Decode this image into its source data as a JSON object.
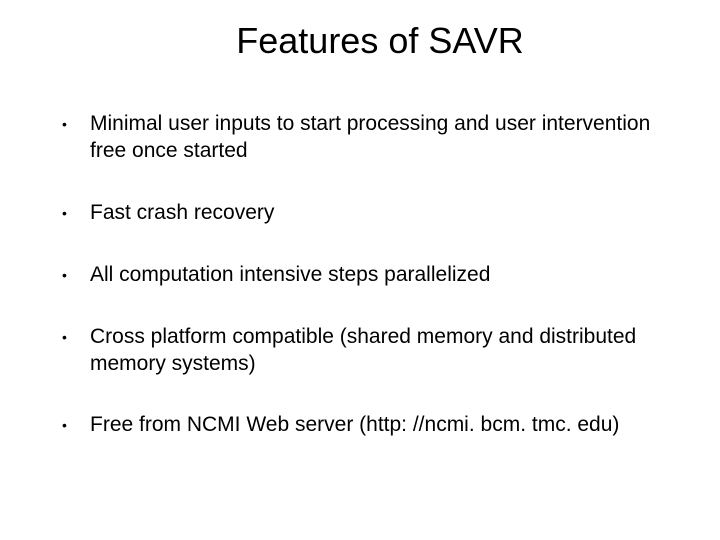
{
  "title": "Features of SAVR",
  "bullets": [
    "Minimal user inputs to start processing and user intervention free once started",
    "Fast crash recovery",
    "All computation intensive steps parallelized",
    "Cross platform compatible (shared memory and distributed memory systems)",
    "Free from NCMI Web server (http: //ncmi. bcm. tmc. edu)"
  ]
}
